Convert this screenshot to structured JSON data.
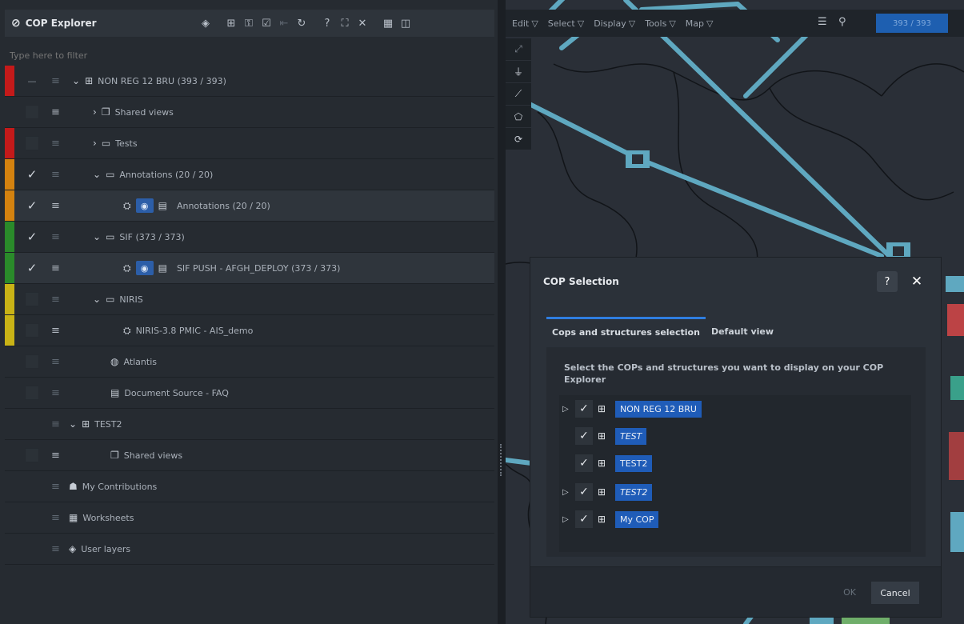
{
  "explorer": {
    "title": "COP Explorer",
    "filter_placeholder": "Type here to filter",
    "toolbar_icons": [
      "layers-icon",
      "structure-icon",
      "key-icon",
      "checkbox-icon",
      "collapse-icon",
      "refresh-icon",
      "help-icon",
      "expand-icon",
      "close-icon",
      "grid-icon",
      "panel-icon"
    ],
    "tree": [
      {
        "label": "NON REG 12 BRU (393 / 393)",
        "stripe": "#c41a1a"
      },
      {
        "label": "Shared views",
        "stripe": ""
      },
      {
        "label": "Tests",
        "stripe": "#c41a1a"
      },
      {
        "label": "Annotations (20 / 20)",
        "stripe": "#d4820f"
      },
      {
        "label": "Annotations (20 / 20)",
        "stripe": "#d4820f"
      },
      {
        "label": "SIF (373 / 373)",
        "stripe": "#2a8a2a"
      },
      {
        "label": "SIF PUSH - AFGH_DEPLOY (373 / 373)",
        "stripe": "#2a8a2a"
      },
      {
        "label": "NIRIS",
        "stripe": "#c9b316"
      },
      {
        "label": "NIRIS-3.8 PMIC - AIS_demo",
        "stripe": "#c9b316"
      },
      {
        "label": "Atlantis",
        "stripe": ""
      },
      {
        "label": "Document Source - FAQ",
        "stripe": ""
      },
      {
        "label": "TEST2",
        "stripe": ""
      },
      {
        "label": "Shared views",
        "stripe": ""
      },
      {
        "label": "My Contributions",
        "stripe": ""
      },
      {
        "label": "Worksheets",
        "stripe": ""
      },
      {
        "label": "User layers",
        "stripe": ""
      }
    ]
  },
  "map": {
    "menus": [
      "Edit",
      "Select",
      "Display",
      "Tools",
      "Map"
    ],
    "counter": "393 / 393"
  },
  "dialog": {
    "title": "COP Selection",
    "tabs": [
      "Cops and structures selection",
      "Default view"
    ],
    "instructions": "Select the COPs and structures you want to display on your COP Explorer",
    "items": [
      "NON REG 12 BRU",
      "TEST",
      "TEST2",
      "TEST2",
      "My COP"
    ],
    "ok_label": "OK",
    "cancel_label": "Cancel"
  },
  "colors": {
    "accent": "#1f5cb8",
    "red": "#c41a1a",
    "orange": "#d4820f",
    "green": "#2a8a2a",
    "yellow": "#c9b316"
  }
}
